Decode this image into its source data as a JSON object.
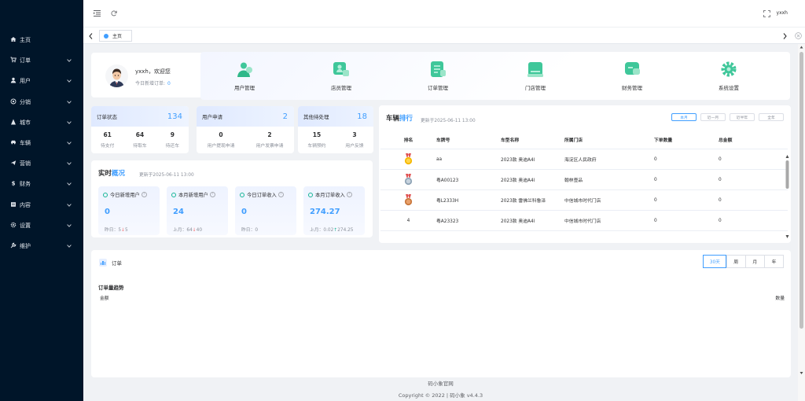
{
  "sidebar": {
    "items": [
      {
        "icon": "home-icon",
        "label": "主页",
        "has_arrow": false
      },
      {
        "icon": "cart-icon",
        "label": "订单",
        "has_arrow": true
      },
      {
        "icon": "user-icon",
        "label": "用户",
        "has_arrow": true
      },
      {
        "icon": "distribution-icon",
        "label": "分销",
        "has_arrow": true
      },
      {
        "icon": "city-icon",
        "label": "城市",
        "has_arrow": true
      },
      {
        "icon": "car-icon",
        "label": "车辆",
        "has_arrow": true
      },
      {
        "icon": "marketing-icon",
        "label": "营销",
        "has_arrow": true
      },
      {
        "icon": "finance-icon",
        "label": "财务",
        "has_arrow": true
      },
      {
        "icon": "content-icon",
        "label": "内容",
        "has_arrow": true
      },
      {
        "icon": "settings-icon",
        "label": "设置",
        "has_arrow": true
      },
      {
        "icon": "maintenance-icon",
        "label": "维护",
        "has_arrow": true
      }
    ]
  },
  "header": {
    "username": "yxxh"
  },
  "tabs": {
    "home_label": "主页"
  },
  "welcome": {
    "greeting": "yxxh，欢迎您",
    "today_new_orders_label": "今日新增订单:",
    "today_new_orders": "0"
  },
  "quick_actions": [
    {
      "icon": "user-manage-icon",
      "label": "用户管理",
      "color": "#3fc79a"
    },
    {
      "icon": "staff-manage-icon",
      "label": "店员管理",
      "color": "#3fc79a"
    },
    {
      "icon": "order-manage-icon",
      "label": "订单管理",
      "color": "#3fc79a"
    },
    {
      "icon": "store-manage-icon",
      "label": "门店管理",
      "color": "#3fc79a"
    },
    {
      "icon": "finance-manage-icon",
      "label": "财务管理",
      "color": "#3fc79a"
    },
    {
      "icon": "system-settings-icon",
      "label": "系统设置",
      "color": "#3fc79a"
    }
  ],
  "stats": [
    {
      "title": "订单状态",
      "total": "134",
      "cols": [
        {
          "value": "61",
          "label": "待支付"
        },
        {
          "value": "64",
          "label": "待取车"
        },
        {
          "value": "9",
          "label": "待还车"
        }
      ]
    },
    {
      "title": "用户申请",
      "total": "2",
      "cols": [
        {
          "value": "0",
          "label": "用户提现申请"
        },
        {
          "value": "2",
          "label": "用户发票申请"
        }
      ]
    },
    {
      "title": "其他待处理",
      "total": "18",
      "cols": [
        {
          "value": "15",
          "label": "车辆预约"
        },
        {
          "value": "3",
          "label": "用户反馈"
        }
      ]
    }
  ],
  "realtime": {
    "title_prefix": "实时",
    "title_highlight": "概况",
    "updated": "更新于2025-06-11 13:00",
    "boxes": [
      {
        "label": "今日新增用户",
        "value": "0",
        "sub_label": "昨日：",
        "sub_value": "5",
        "trend": "down",
        "trend_value": "5"
      },
      {
        "label": "本月新增用户",
        "value": "24",
        "sub_label": "上月：",
        "sub_value": "64",
        "trend": "down",
        "trend_value": "40"
      },
      {
        "label": "今日订单收入",
        "value": "0",
        "sub_label": "昨日：",
        "sub_value": "0",
        "trend": "",
        "trend_value": ""
      },
      {
        "label": "本月订单收入",
        "value": "274.27",
        "sub_label": "上月：",
        "sub_value": "0.02",
        "trend": "up",
        "trend_value": "274.25"
      }
    ]
  },
  "ranking": {
    "title_prefix": "车辆",
    "title_highlight": "排行",
    "updated": "更新于2025-06-11 13:00",
    "buttons": [
      "本月",
      "近一月",
      "近半年",
      "全年"
    ],
    "active_button": 0,
    "columns": [
      "排名",
      "车牌号",
      "车型名称",
      "所属门店",
      "下单数量",
      "总金额"
    ],
    "rows": [
      {
        "rank": "1",
        "medal": "gold",
        "plate": "aa",
        "model": "2023款 奥迪A4l",
        "store": "海淀区人民政府",
        "qty": "0",
        "amount": "0"
      },
      {
        "rank": "2",
        "medal": "silver",
        "plate": "粤A00123",
        "model": "2023款 奥迪A4l",
        "store": "翰林壹品",
        "qty": "0",
        "amount": "0"
      },
      {
        "rank": "3",
        "medal": "bronze",
        "plate": "粤L2333H",
        "model": "2023款 雷佛兰科鲁泽",
        "store": "中信城市时代门店",
        "qty": "0",
        "amount": "0"
      },
      {
        "rank": "4",
        "medal": "",
        "plate": "粤A23323",
        "model": "2023款 奥迪A4l",
        "store": "中信城市时代门店",
        "qty": "0",
        "amount": "0"
      }
    ]
  },
  "orders": {
    "title": "订单",
    "segments": [
      "30天",
      "周",
      "月",
      "年"
    ],
    "active_segment": 0,
    "chart_title": "订单量趋势",
    "y_left": "金额",
    "y_right": "数量"
  },
  "footer": {
    "line1": "码小象官网",
    "line2": "Copyright © 2022 | 码小象 v4.4.3"
  }
}
